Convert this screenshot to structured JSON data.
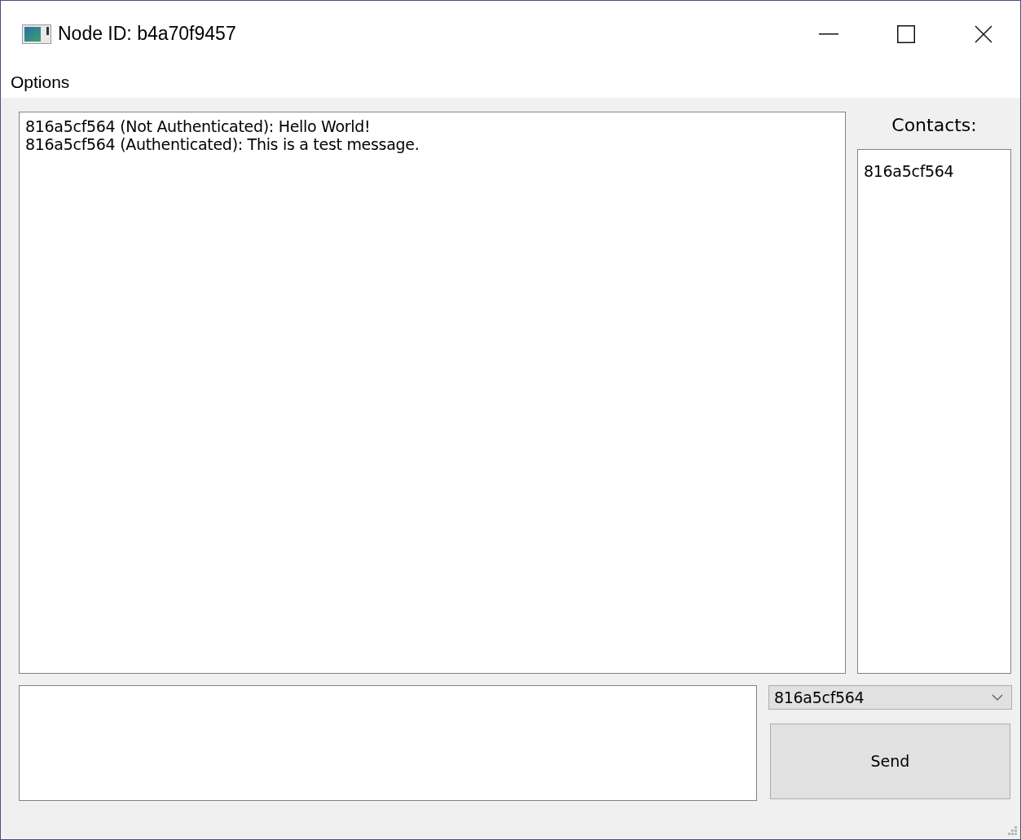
{
  "window": {
    "title": "Node ID: b4a70f9457"
  },
  "menu": [
    {
      "label": "Options"
    }
  ],
  "messages": [
    "816a5cf564 (Not Authenticated): Hello World!",
    "816a5cf564 (Authenticated): This is a test message."
  ],
  "contacts": {
    "label": "Contacts:",
    "items": [
      {
        "name": "816a5cf564",
        "selected": false
      }
    ]
  },
  "recipient": {
    "value": "816a5cf564"
  },
  "send_button": {
    "label": "Send"
  }
}
